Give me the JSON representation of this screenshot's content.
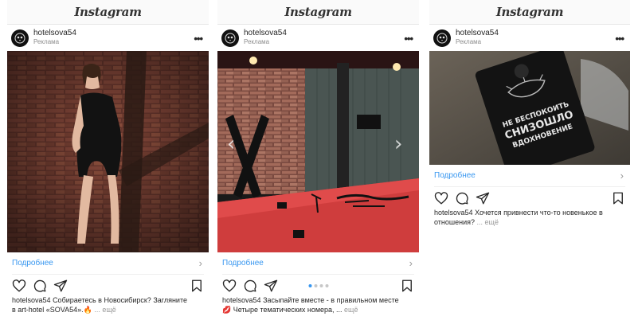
{
  "app": {
    "name": "Instagram"
  },
  "posts": [
    {
      "username": "hotelsova54",
      "sponsored": "Реклама",
      "cta": "Подробнее",
      "caption_user": "hotelsova54",
      "caption_line1": "Собираетесь в Новосибирск? Загляните",
      "caption_line2": "в art-hotel «SOVA54».🔥",
      "caption_more": "... ещё"
    },
    {
      "username": "hotelsova54",
      "sponsored": "Реклама",
      "cta": "Подробнее",
      "caption_user": "hotelsova54",
      "caption_line1": "Засыпайте вместе - в правильном месте",
      "caption_line2": "💋 Четыре тематических номера, ...",
      "caption_more": "ещё",
      "carousel": {
        "count": 4,
        "active": 1
      }
    },
    {
      "username": "hotelsova54",
      "sponsored": "Реклама",
      "cta": "Подробнее",
      "caption_user": "hotelsova54",
      "caption_line1": "Хочется привнести что-то новенькое в",
      "caption_line2": "отношения?",
      "caption_more": "... ещё",
      "sign_text": [
        "НЕ БЕСПОКОИТЬ",
        "СНИЗОШЛО",
        "ВДОХНОВЕНИЕ"
      ]
    }
  ],
  "icons": {
    "like": "heart-icon",
    "comment": "comment-icon",
    "share": "paper-plane-icon",
    "save": "bookmark-icon",
    "more": "more-dots-icon",
    "chevron": "chevron-right-icon"
  },
  "colors": {
    "link": "#3897f0",
    "muted": "#8e8e8e"
  }
}
